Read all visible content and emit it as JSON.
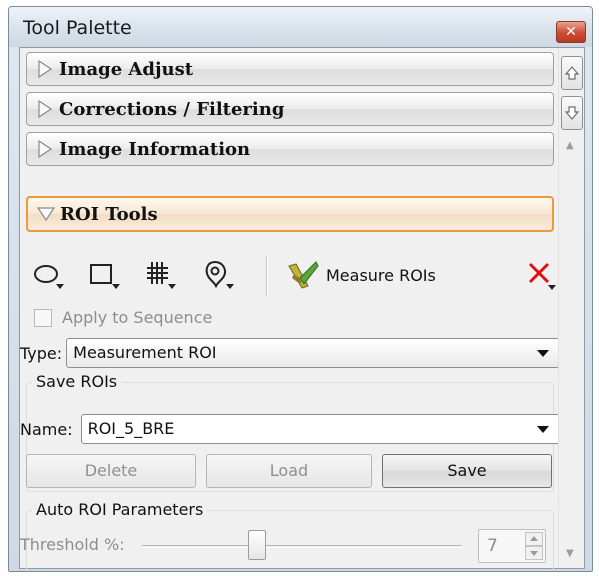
{
  "window": {
    "title": "Tool Palette",
    "close_icon": "close-icon"
  },
  "sections": [
    {
      "label": "Image Adjust",
      "expanded": false
    },
    {
      "label": "Corrections / Filtering",
      "expanded": false
    },
    {
      "label": "Image Information",
      "expanded": false
    },
    {
      "label": "ROI Tools",
      "expanded": true
    }
  ],
  "roi_tools": {
    "tools": [
      "ellipse-roi-icon",
      "rectangle-roi-icon",
      "grid-roi-icon",
      "freehand-roi-icon"
    ],
    "measure_label": "Measure ROIs",
    "delete_roi_icon": "red-x-icon",
    "apply_to_sequence": "Apply to Sequence",
    "type_label": "Type:",
    "type_value": "Measurement ROI",
    "save_group_title": "Save ROIs",
    "name_label": "Name:",
    "name_value": "ROI_5_BRE",
    "delete_label": "Delete",
    "load_label": "Load",
    "save_label": "Save",
    "auto_group_title": "Auto ROI Parameters",
    "threshold_label": "Threshold %:",
    "threshold_value": "7",
    "threshold_level_fraction": 0.36
  },
  "colors": {
    "active_border": "#e99a3a",
    "close_red": "#cc4b35",
    "x_red": "#e01010"
  }
}
